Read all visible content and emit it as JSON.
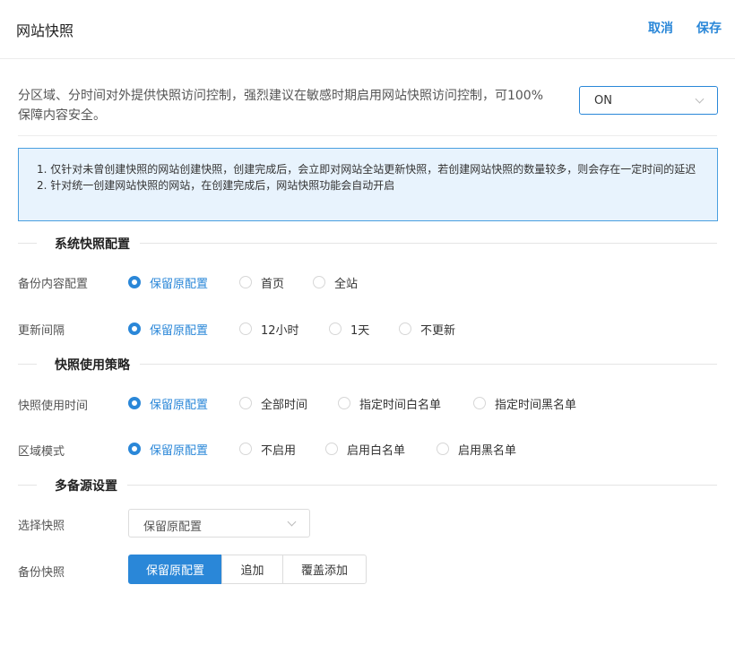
{
  "header": {
    "title": "网站快照",
    "cancel_label": "取消",
    "save_label": "保存"
  },
  "intro": {
    "description": "分区域、分时间对外提供快照访问控制，强烈建议在敏感时期启用网站快照访问控制，可100%保障内容安全。",
    "switch_value": "ON"
  },
  "notice": {
    "line1": "1. 仅针对未曾创建快照的网站创建快照，创建完成后，会立即对网站全站更新快照，若创建网站快照的数量较多，则会存在一定时间的延迟",
    "line2": "2. 针对统一创建网站快照的网站，在创建完成后，网站快照功能会自动开启"
  },
  "sections": {
    "system": "系统快照配置",
    "policy": "快照使用策略",
    "multi": "多备源设置"
  },
  "backup_content": {
    "label": "备份内容配置",
    "options": [
      "保留原配置",
      "首页",
      "全站"
    ],
    "selected": "保留原配置"
  },
  "update_interval": {
    "label": "更新间隔",
    "options": [
      "保留原配置",
      "12小时",
      "1天",
      "不更新"
    ],
    "selected": "保留原配置"
  },
  "use_time": {
    "label": "快照使用时间",
    "options": [
      "保留原配置",
      "全部时间",
      "指定时间白名单",
      "指定时间黑名单"
    ],
    "selected": "保留原配置"
  },
  "region_mode": {
    "label": "区域模式",
    "options": [
      "保留原配置",
      "不启用",
      "启用白名单",
      "启用黑名单"
    ],
    "selected": "保留原配置"
  },
  "select_snapshot": {
    "label": "选择快照",
    "value": "保留原配置"
  },
  "backup_snapshot": {
    "label": "备份快照",
    "buttons": [
      "保留原配置",
      "追加",
      "覆盖添加"
    ],
    "active": "保留原配置"
  },
  "colors": {
    "accent": "#2a87d8",
    "notice_bg": "#e8f3fd",
    "notice_border": "#4a9fe0"
  }
}
